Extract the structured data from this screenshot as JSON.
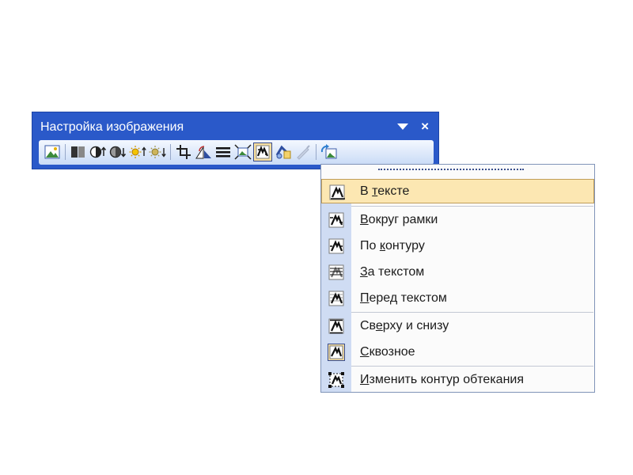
{
  "toolbar": {
    "title": "Настройка изображения",
    "dropdown_icon": "dropdown-arrow-icon",
    "close_label": "×",
    "tools": [
      {
        "name": "insert-picture-icon"
      },
      {
        "name": "color-icon"
      },
      {
        "name": "more-contrast-icon"
      },
      {
        "name": "less-contrast-icon"
      },
      {
        "name": "more-brightness-icon"
      },
      {
        "name": "less-brightness-icon"
      },
      {
        "name": "crop-icon"
      },
      {
        "name": "rotate-left-icon"
      },
      {
        "name": "line-style-icon"
      },
      {
        "name": "compress-pictures-icon"
      },
      {
        "name": "text-wrapping-icon",
        "active": true
      },
      {
        "name": "format-picture-icon"
      },
      {
        "name": "set-transparent-color-icon",
        "disabled": true
      },
      {
        "name": "reset-picture-icon"
      }
    ]
  },
  "menu": {
    "items": [
      {
        "pre": "В ",
        "key": "т",
        "post": "ексте",
        "highlighted": true
      },
      {
        "pre": "",
        "key": "В",
        "post": "округ рамки"
      },
      {
        "pre": "По ",
        "key": "к",
        "post": "онтуру"
      },
      {
        "pre": "",
        "key": "З",
        "post": "а текстом"
      },
      {
        "pre": "",
        "key": "П",
        "post": "еред текстом"
      },
      {
        "pre": "Св",
        "key": "е",
        "post": "рху и снизу"
      },
      {
        "pre": "",
        "key": "С",
        "post": "квозное"
      },
      {
        "pre": "",
        "key": "И",
        "post": "зменить контур обтекания"
      }
    ]
  },
  "colors": {
    "title_bar": "#2a59c9",
    "menu_highlight": "#fce7b2",
    "menu_gutter": "#cfdcf3"
  }
}
